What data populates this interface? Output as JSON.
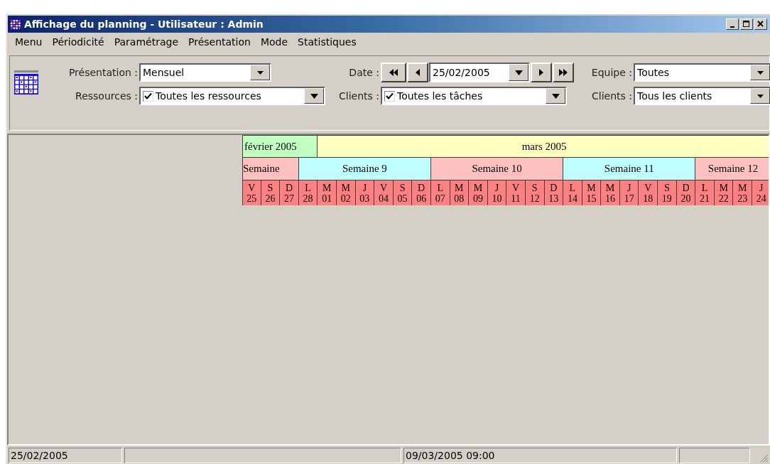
{
  "window": {
    "title": "Affichage du planning - Utilisateur : Admin"
  },
  "menu": [
    "Menu",
    "Périodicité",
    "Paramétrage",
    "Présentation",
    "Mode",
    "Statistiques"
  ],
  "toolbar": {
    "presentation": {
      "label": "Présentation :",
      "value": "Mensuel"
    },
    "ressources": {
      "label": "Ressources :",
      "checked": true,
      "value": "Toutes les ressources"
    },
    "date": {
      "label": "Date :",
      "value": "25/02/2005"
    },
    "clients_tasks": {
      "label": "Clients :",
      "checked": true,
      "value": "Toutes les tâches"
    },
    "equipe": {
      "label": "Equipe :",
      "value": "Toutes"
    },
    "clients": {
      "label": "Clients :",
      "value": "Tous les clients"
    }
  },
  "planning": {
    "months": [
      {
        "label": "février 2005",
        "color": "#c0ffc0"
      },
      {
        "label": "mars 2005",
        "color": "#ffffc0"
      }
    ],
    "weeks": [
      {
        "label": "Semaine",
        "color": "#ffc0c0",
        "days": [
          {
            "letter": "V",
            "number": "25"
          },
          {
            "letter": "S",
            "number": "26"
          },
          {
            "letter": "D",
            "number": "27"
          }
        ]
      },
      {
        "label": "Semaine 9",
        "color": "#c0ffff",
        "days": [
          {
            "letter": "L",
            "number": "28"
          },
          {
            "letter": "M",
            "number": "01"
          },
          {
            "letter": "M",
            "number": "02"
          },
          {
            "letter": "J",
            "number": "03"
          },
          {
            "letter": "V",
            "number": "04"
          },
          {
            "letter": "S",
            "number": "05"
          },
          {
            "letter": "D",
            "number": "06"
          }
        ]
      },
      {
        "label": "Semaine 10",
        "color": "#ffc0c0",
        "days": [
          {
            "letter": "L",
            "number": "07"
          },
          {
            "letter": "M",
            "number": "08"
          },
          {
            "letter": "M",
            "number": "09"
          },
          {
            "letter": "J",
            "number": "10"
          },
          {
            "letter": "V",
            "number": "11"
          },
          {
            "letter": "S",
            "number": "12"
          },
          {
            "letter": "D",
            "number": "13"
          }
        ]
      },
      {
        "label": "Semaine 11",
        "color": "#c0ffff",
        "days": [
          {
            "letter": "L",
            "number": "14"
          },
          {
            "letter": "M",
            "number": "15"
          },
          {
            "letter": "M",
            "number": "16"
          },
          {
            "letter": "J",
            "number": "17"
          },
          {
            "letter": "V",
            "number": "18"
          },
          {
            "letter": "S",
            "number": "19"
          },
          {
            "letter": "D",
            "number": "20"
          }
        ]
      },
      {
        "label": "Semaine 12",
        "color": "#ffc0c0",
        "days": [
          {
            "letter": "L",
            "number": "21"
          },
          {
            "letter": "M",
            "number": "22"
          },
          {
            "letter": "M",
            "number": "23"
          },
          {
            "letter": "J",
            "number": "24"
          }
        ]
      }
    ]
  },
  "status_bar": {
    "date": "25/02/2005",
    "datetime": "09/03/2005 09:00"
  }
}
